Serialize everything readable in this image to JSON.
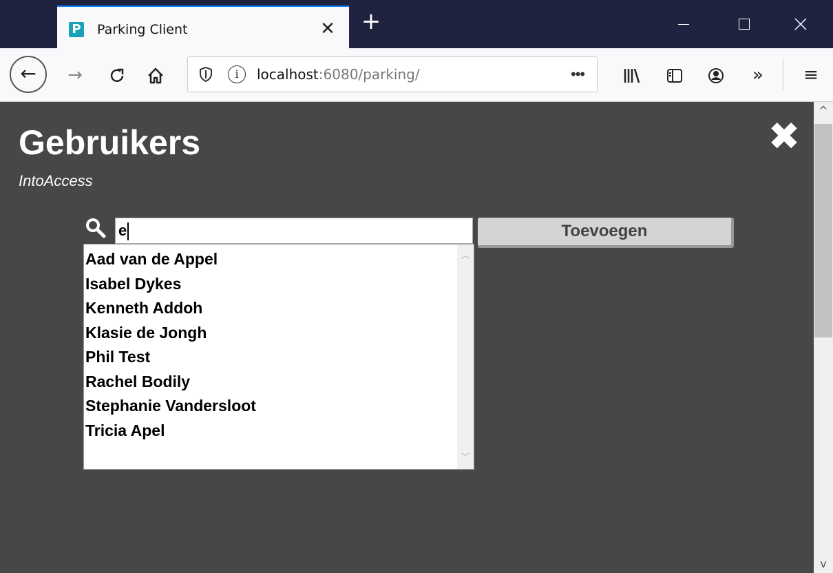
{
  "browser": {
    "tab_favicon": "P",
    "tab_title": "Parking Client",
    "tab_close": "✕",
    "new_tab": "+",
    "url_host": "localhost",
    "url_rest": ":6080/parking/",
    "url_more": "•••"
  },
  "page": {
    "title": "Gebruikers",
    "subtitle": "IntoAccess",
    "close_glyph": "✖"
  },
  "search": {
    "value": "e"
  },
  "add_button_label": "Toevoegen",
  "users": [
    "Aad van de Appel",
    "Isabel Dykes",
    "Kenneth Addoh",
    "Klasie de Jongh",
    "Phil Test",
    "Rachel Bodily",
    "Stephanie Vandersloot",
    "Tricia Apel"
  ],
  "colors": {
    "page_background": "#474747",
    "tab_strip": "#202340",
    "tab_active_border": "#0a84ff"
  }
}
